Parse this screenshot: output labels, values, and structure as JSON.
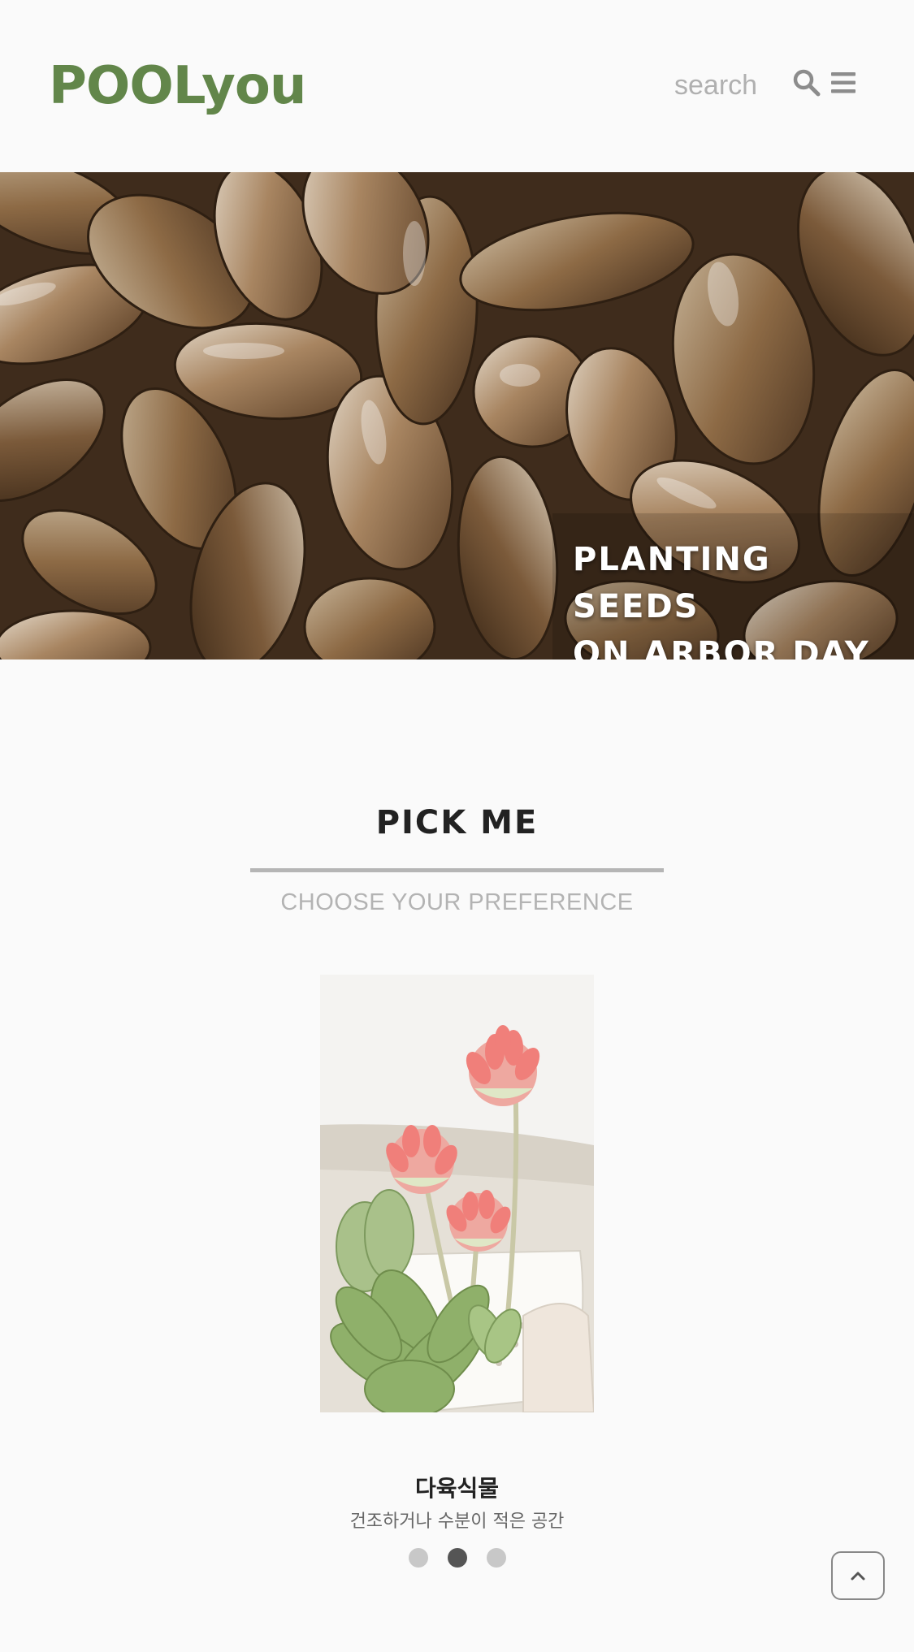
{
  "header": {
    "logo": "POOLyou",
    "search_placeholder": "search",
    "search_icon": "search-icon",
    "menu_icon": "hamburger-menu-icon"
  },
  "hero": {
    "title_line1": "PLANTING SEEDS",
    "title_line2": "ON ARBOR DAY"
  },
  "pick": {
    "title": "PICK ME",
    "subtitle": "CHOOSE YOUR PREFERENCE"
  },
  "carousel": {
    "items": [
      {
        "name": "다육식물",
        "description": "건조하거나 수분이 적은 공간"
      }
    ],
    "dot_count": 3,
    "active_index": 1
  },
  "scroll_top_icon": "chevron-up-icon",
  "colors": {
    "brand": "#62864a",
    "background": "#fafafa",
    "rule": "#b5b5b5",
    "dot_active": "#555555",
    "dot_inactive": "#c8c8c8"
  }
}
